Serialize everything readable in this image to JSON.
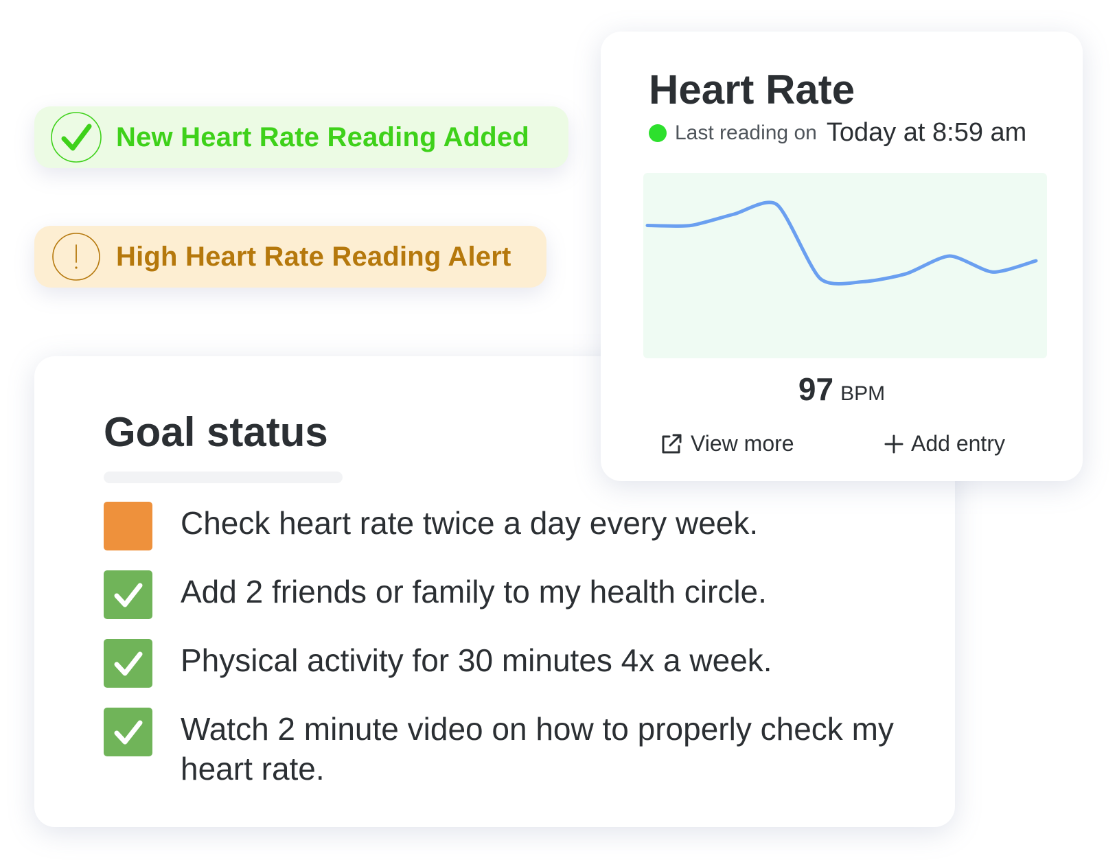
{
  "toasts": {
    "success": {
      "text": "New Heart Rate Reading Added",
      "icon": "check-circle-icon",
      "color": "#3ed11a",
      "background": "#ecfbe4"
    },
    "alert": {
      "text": "High Heart Rate Reading Alert",
      "icon": "exclamation-circle-icon",
      "color": "#b5780c",
      "background": "#fdeed2"
    }
  },
  "goal_status": {
    "title": "Goal status",
    "items": [
      {
        "text": "Check heart rate twice a day every week.",
        "status": "pending",
        "color": "#ee913c"
      },
      {
        "text": "Add 2 friends or family to my health circle.",
        "status": "done",
        "color": "#70b459"
      },
      {
        "text": "Physical activity for 30 minutes 4x a week.",
        "status": "done",
        "color": "#70b459"
      },
      {
        "text": "Watch 2 minute video on how to properly check my heart rate.",
        "status": "done",
        "color": "#70b459"
      }
    ]
  },
  "heart_rate": {
    "title": "Heart Rate",
    "status_dot_color": "#2de02d",
    "last_reading_label": "Last reading on",
    "last_reading_time": "Today at 8:59 am",
    "value": "97",
    "unit": "BPM",
    "view_more_label": "View more",
    "view_more_icon": "external-link-icon",
    "add_entry_label": "Add entry",
    "add_entry_icon": "plus-icon"
  },
  "chart_data": {
    "type": "line",
    "title": "",
    "xlabel": "",
    "ylabel": "",
    "grid": false,
    "line_color": "#6a9ff0",
    "area_color": "#effbf3",
    "ylim": [
      0,
      100
    ],
    "x": [
      0,
      1,
      2,
      3,
      4,
      5,
      6,
      7,
      8
    ],
    "values": [
      75,
      75,
      82,
      88,
      42,
      40,
      45,
      56,
      46,
      53
    ]
  }
}
